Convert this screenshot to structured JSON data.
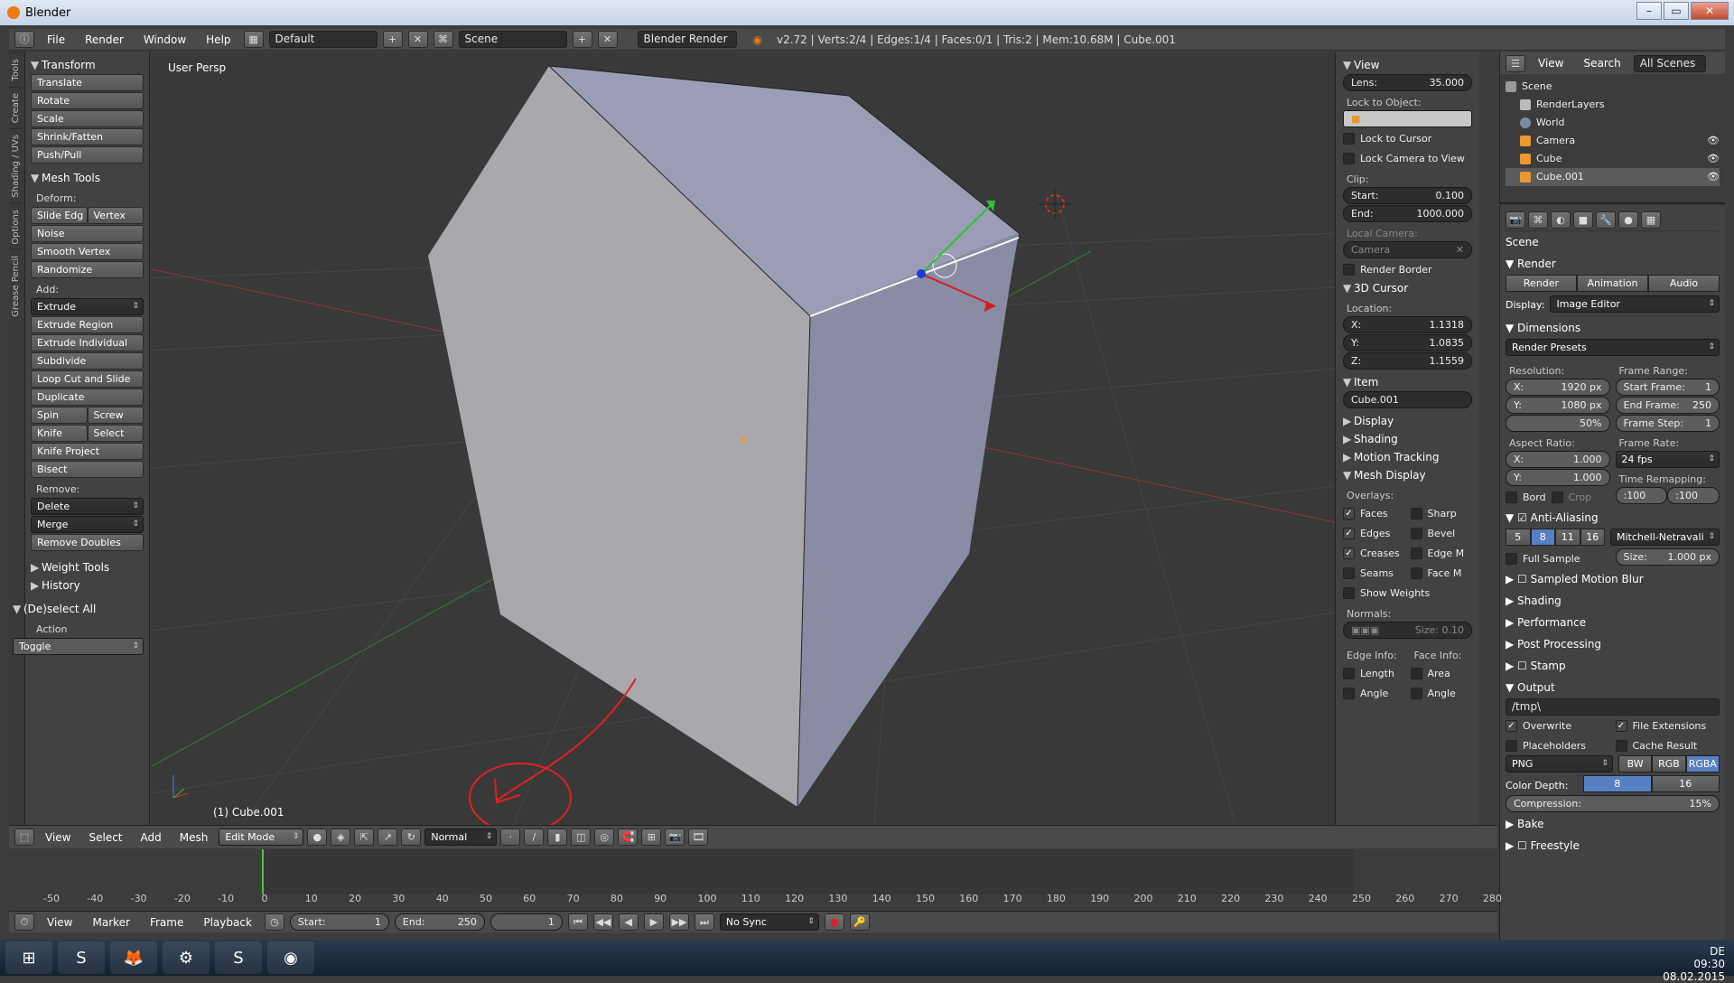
{
  "window": {
    "title": "Blender"
  },
  "info_bar": {
    "menus": [
      "File",
      "Render",
      "Window",
      "Help"
    ],
    "layout": "Default",
    "scene": "Scene",
    "engine": "Blender Render",
    "stats": "v2.72 | Verts:2/4 | Edges:1/4 | Faces:0/1 | Tris:2 | Mem:10.68M | Cube.001"
  },
  "tool_tabs": [
    "Tools",
    "Create",
    "Shading / UVs",
    "Options",
    "Grease Pencil"
  ],
  "tool_shelf": {
    "transform_title": "Transform",
    "transform": [
      "Translate",
      "Rotate",
      "Scale",
      "Shrink/Fatten",
      "Push/Pull"
    ],
    "mesh_tools_title": "Mesh Tools",
    "deform_label": "Deform:",
    "deform_row": [
      "Slide Edg",
      "Vertex"
    ],
    "deform": [
      "Noise",
      "Smooth Vertex",
      "Randomize"
    ],
    "add_label": "Add:",
    "extrude": "Extrude",
    "add": [
      "Extrude Region",
      "Extrude Individual",
      "Subdivide",
      "Loop Cut and Slide",
      "Duplicate"
    ],
    "spin_row": [
      "Spin",
      "Screw"
    ],
    "knife_row": [
      "Knife",
      "Select"
    ],
    "add2": [
      "Knife Project",
      "Bisect"
    ],
    "remove_label": "Remove:",
    "delete": "Delete",
    "merge": "Merge",
    "remove_doubles": "Remove Doubles",
    "weight_tools": "Weight Tools",
    "history": "History",
    "deselect_title": "(De)select All",
    "action_label": "Action",
    "action_value": "Toggle"
  },
  "viewport": {
    "view_label": "User Persp",
    "object_label": "(1) Cube.001"
  },
  "n_panel": {
    "view_title": "View",
    "lens": {
      "label": "Lens:",
      "value": "35.000"
    },
    "lock_object": "Lock to Object:",
    "lock_cursor": "Lock to Cursor",
    "lock_camera": "Lock Camera to View",
    "clip": "Clip:",
    "clip_start": {
      "label": "Start:",
      "value": "0.100"
    },
    "clip_end": {
      "label": "End:",
      "value": "1000.000"
    },
    "local_camera": "Local Camera:",
    "camera": "Camera",
    "render_border": "Render Border",
    "cursor_title": "3D Cursor",
    "location": "Location:",
    "cx": {
      "label": "X:",
      "value": "1.1318"
    },
    "cy": {
      "label": "Y:",
      "value": "1.0835"
    },
    "cz": {
      "label": "Z:",
      "value": "1.1559"
    },
    "item_title": "Item",
    "item_name": "Cube.001",
    "display": "Display",
    "shading": "Shading",
    "motion_tracking": "Motion Tracking",
    "mesh_display": "Mesh Display",
    "overlays": "Overlays:",
    "ov_left": [
      "Faces",
      "Edges",
      "Creases",
      "Seams"
    ],
    "ov_right": [
      "Sharp",
      "Bevel",
      "Edge M",
      "Face M"
    ],
    "show_weights": "Show Weights",
    "normals": "Normals:",
    "normals_size": "Size: 0.10",
    "edge_info": "Edge Info:",
    "face_info": "Face Info:",
    "ei": [
      "Length",
      "Angle"
    ],
    "fi": [
      "Area",
      "Angle"
    ]
  },
  "outliner": {
    "menus": [
      "View",
      "Search"
    ],
    "filter": "All Scenes",
    "rows": [
      "Scene",
      "RenderLayers",
      "World",
      "Camera",
      "Cube",
      "Cube.001"
    ]
  },
  "properties": {
    "scene": "Scene",
    "render_title": "Render",
    "render_btns": [
      "Render",
      "Animation",
      "Audio"
    ],
    "display_label": "Display:",
    "display_value": "Image Editor",
    "dimensions": "Dimensions",
    "render_presets": "Render Presets",
    "resolution": "Resolution:",
    "frame_range": "Frame Range:",
    "rx": {
      "label": "X:",
      "value": "1920 px"
    },
    "ry": {
      "label": "Y:",
      "value": "1080 px"
    },
    "rp": "50%",
    "sf": {
      "label": "Start Frame:",
      "value": "1"
    },
    "ef": {
      "label": "End Frame:",
      "value": "250"
    },
    "fs": {
      "label": "Frame Step:",
      "value": "1"
    },
    "aspect": "Aspect Ratio:",
    "frame_rate": "Frame Rate:",
    "ax": {
      "label": "X:",
      "value": "1.000"
    },
    "ay": {
      "label": "Y:",
      "value": "1.000"
    },
    "fps": "24 fps",
    "time_remap": "Time Remapping:",
    "remap_old": ":100",
    "remap_new": ":100",
    "bord": "Bord",
    "crop": "Crop",
    "anti_aliasing": "Anti-Aliasing",
    "aa_samples": [
      "5",
      "8",
      "11",
      "16"
    ],
    "aa_filter": "Mitchell-Netravali",
    "full_sample": "Full Sample",
    "aa_size": {
      "label": "Size:",
      "value": "1.000 px"
    },
    "collapsed": [
      "Sampled Motion Blur",
      "Shading",
      "Performance",
      "Post Processing",
      "Stamp"
    ],
    "output": "Output",
    "output_path": "/tmp\\",
    "overwrite": "Overwrite",
    "file_ext": "File Extensions",
    "placeholders": "Placeholders",
    "cache_result": "Cache Result",
    "format": "PNG",
    "color_modes": [
      "BW",
      "RGB",
      "RGBA"
    ],
    "color_depth": "Color Depth:",
    "depths": [
      "8",
      "16"
    ],
    "compression": {
      "label": "Compression:",
      "value": "15%"
    },
    "bake": "Bake",
    "freestyle": "Freestyle"
  },
  "view3d_header": {
    "menus": [
      "View",
      "Select",
      "Add",
      "Mesh"
    ],
    "mode": "Edit Mode",
    "orientation": "Normal"
  },
  "timeline": {
    "ticks": [
      "-50",
      "-40",
      "-30",
      "-20",
      "-10",
      "0",
      "10",
      "20",
      "30",
      "40",
      "50",
      "60",
      "70",
      "80",
      "90",
      "100",
      "110",
      "120",
      "130",
      "140",
      "150",
      "160",
      "170",
      "180",
      "190",
      "200",
      "210",
      "220",
      "230",
      "240",
      "250",
      "260",
      "270",
      "280"
    ],
    "menus": [
      "View",
      "Marker",
      "Frame",
      "Playback"
    ],
    "start": {
      "label": "Start:",
      "value": "1"
    },
    "end": {
      "label": "End:",
      "value": "250"
    },
    "current": "1",
    "sync": "No Sync"
  },
  "taskbar": {
    "lang": "DE",
    "time": "09:30",
    "date": "08.02.2015"
  },
  "colors": {
    "face": "#a9a9ad",
    "face_side": "#8a8ca3",
    "face_top": "#9b9db5",
    "annotation": "#e02020"
  }
}
